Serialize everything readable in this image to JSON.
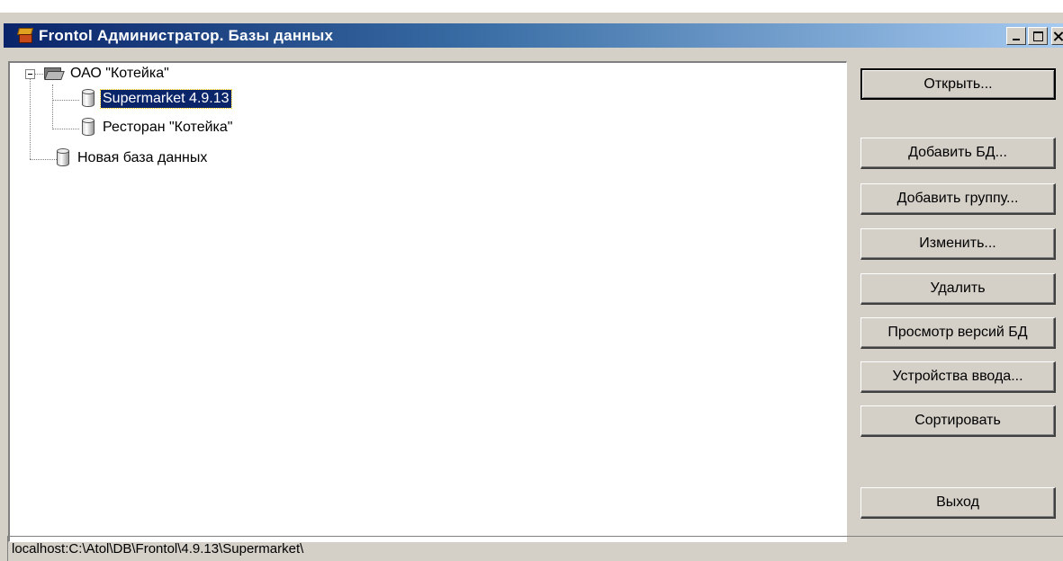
{
  "window": {
    "title": "Frontol Администратор.  Базы данных"
  },
  "tree": {
    "nodes": [
      {
        "label": "ОАО \"Котейка\"",
        "icon": "folder-icon",
        "expanded": true
      },
      {
        "label": "Supermarket 4.9.13",
        "icon": "database-icon",
        "selected": true
      },
      {
        "label": "Ресторан \"Котейка\"",
        "icon": "database-icon"
      },
      {
        "label": "Новая база данных",
        "icon": "database-icon"
      }
    ]
  },
  "buttons": {
    "open": "Открыть...",
    "add_db": "Добавить БД...",
    "add_group": "Добавить группу...",
    "edit": "Изменить...",
    "delete": "Удалить",
    "view_versions": "Просмотр версий БД",
    "input_devices": "Устройства ввода...",
    "sort": "Сортировать",
    "exit": "Выход"
  },
  "status_bar": {
    "path": "localhost:C:\\Atol\\DB\\Frontol\\4.9.13\\Supermarket\\"
  },
  "colors": {
    "titlebar_start": "#0a246a",
    "titlebar_end": "#a6caf0",
    "selection": "#0a246a",
    "face": "#d4d0c8"
  }
}
